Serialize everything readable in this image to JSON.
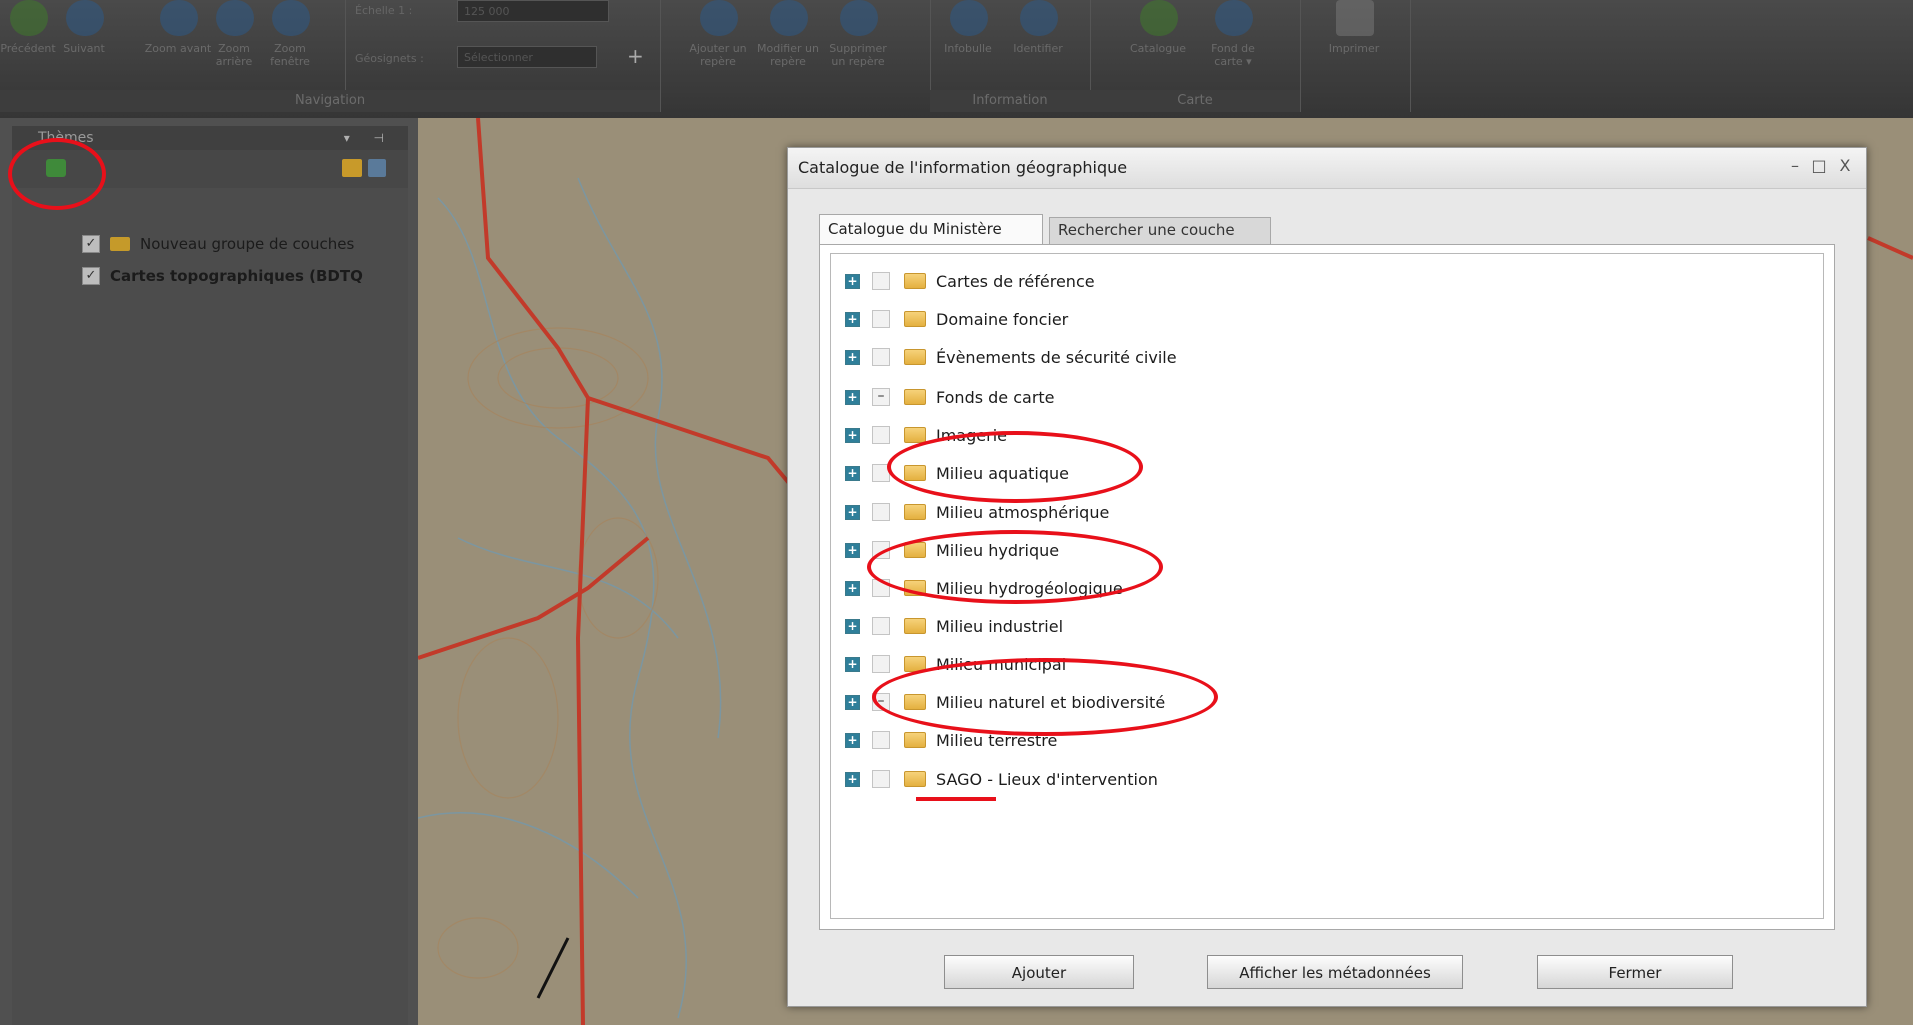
{
  "ribbon": {
    "buttons": [
      {
        "label": "Précédent",
        "icon": "back-arrow-icon"
      },
      {
        "label": "Suivant",
        "icon": "forward-arrow-icon"
      },
      {
        "label": "Zoom avant",
        "icon": "zoom-in-icon"
      },
      {
        "label": "Zoom arrière",
        "icon": "zoom-out-icon"
      },
      {
        "label": "Zoom fenêtre",
        "icon": "zoom-window-icon"
      }
    ],
    "scale_label": "Échelle 1 :",
    "scale_value": "125 000",
    "bookmarks_label": "Géosignets :",
    "bookmarks_placeholder": "Sélectionner",
    "bookmark_buttons": [
      {
        "label": "Ajouter un repère",
        "icon": "add-marker-icon"
      },
      {
        "label": "Modifier un repère",
        "icon": "edit-marker-icon"
      },
      {
        "label": "Supprimer un repère",
        "icon": "delete-marker-icon"
      }
    ],
    "info_buttons": [
      {
        "label": "Infobulle",
        "icon": "tooltip-icon"
      },
      {
        "label": "Identifier",
        "icon": "info-icon"
      }
    ],
    "map_buttons": [
      {
        "label": "Catalogue",
        "icon": "catalog-icon"
      },
      {
        "label": "Fond de carte ▾",
        "icon": "basemap-icon"
      }
    ],
    "print_button": {
      "label": "Imprimer",
      "icon": "printer-icon"
    },
    "groups": {
      "navigation": "Navigation",
      "information": "Information",
      "carte": "Carte"
    }
  },
  "themes_panel": {
    "title": "Thèmes",
    "pin_icons": "▾ ⊣",
    "layers": [
      {
        "label": "Nouveau groupe de couches",
        "checked": true,
        "folder": true
      },
      {
        "label": "Cartes topographiques (BDTQ",
        "checked": true,
        "folder": false
      }
    ]
  },
  "dialog": {
    "title": "Catalogue de l'information géographique",
    "controls": {
      "minimize": "–",
      "maximize": "□",
      "close": "X"
    },
    "tabs": [
      {
        "label": "Catalogue du Ministère",
        "active": true
      },
      {
        "label": "Rechercher une couche",
        "active": false
      }
    ],
    "items": [
      {
        "label": "Cartes de référence",
        "check": ""
      },
      {
        "label": "Domaine foncier",
        "check": ""
      },
      {
        "label": "Évènements de sécurité civile",
        "check": ""
      },
      {
        "label": "Fonds de carte",
        "check": "–"
      },
      {
        "label": "Imagerie",
        "check": ""
      },
      {
        "label": "Milieu aquatique",
        "check": ""
      },
      {
        "label": "Milieu atmosphérique",
        "check": ""
      },
      {
        "label": "Milieu hydrique",
        "check": ""
      },
      {
        "label": "Milieu hydrogéologique",
        "check": ""
      },
      {
        "label": "Milieu industriel",
        "check": ""
      },
      {
        "label": "Milieu municipal",
        "check": ""
      },
      {
        "label": "Milieu naturel et biodiversité",
        "check": "–"
      },
      {
        "label": "Milieu terrestre",
        "check": ""
      },
      {
        "label": "SAGO - Lieux d'intervention",
        "check": ""
      }
    ],
    "buttons": {
      "add": "Ajouter",
      "metadata": "Afficher les métadonnées",
      "close": "Fermer"
    }
  },
  "colors": {
    "annotation": "#e8101a",
    "expander": "#2f7f9a",
    "folder": "#e4b040"
  }
}
